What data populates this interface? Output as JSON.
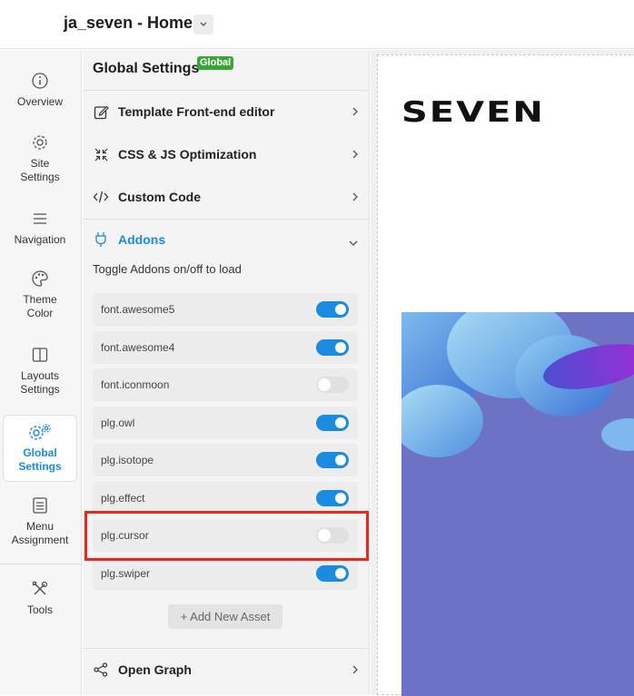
{
  "header": {
    "site_title": "ja_seven - Home"
  },
  "rail": {
    "items": [
      {
        "label": "Overview",
        "icon": "info-icon"
      },
      {
        "label": "Site Settings",
        "icon": "gear-icon"
      },
      {
        "label": "Navigation",
        "icon": "menu-icon"
      },
      {
        "label": "Theme Color",
        "icon": "palette-icon"
      },
      {
        "label": "Layouts Settings",
        "icon": "layout-icon"
      },
      {
        "label": "Global Settings",
        "icon": "gears-icon",
        "active": true
      },
      {
        "label": "Menu Assignment",
        "icon": "list-icon"
      },
      {
        "label": "Tools",
        "icon": "tools-icon"
      }
    ]
  },
  "panel": {
    "title": "Global Settings",
    "badge": "Global",
    "sections": [
      {
        "label": "Template Front-end editor",
        "icon": "edit-icon"
      },
      {
        "label": "CSS & JS Optimization",
        "icon": "compress-icon"
      },
      {
        "label": "Custom Code",
        "icon": "code-icon"
      },
      {
        "label": "Addons",
        "icon": "plug-icon",
        "open": true
      },
      {
        "label": "Open Graph",
        "icon": "share-icon"
      }
    ],
    "addons_hint": "Toggle Addons on/off to load",
    "addons": [
      {
        "name": "font.awesome5",
        "enabled": true
      },
      {
        "name": "font.awesome4",
        "enabled": true
      },
      {
        "name": "font.iconmoon",
        "enabled": false
      },
      {
        "name": "plg.owl",
        "enabled": true
      },
      {
        "name": "plg.isotope",
        "enabled": true
      },
      {
        "name": "plg.effect",
        "enabled": true
      },
      {
        "name": "plg.cursor",
        "enabled": false
      },
      {
        "name": "plg.swiper",
        "enabled": true
      }
    ],
    "add_asset_label": "+ Add New Asset"
  },
  "preview": {
    "logo_text": "SEVEN"
  },
  "colors": {
    "accent": "#1a8be0",
    "badge": "#3aa635",
    "highlight": "#e8291c",
    "hero_bg": "#6d72c4"
  }
}
